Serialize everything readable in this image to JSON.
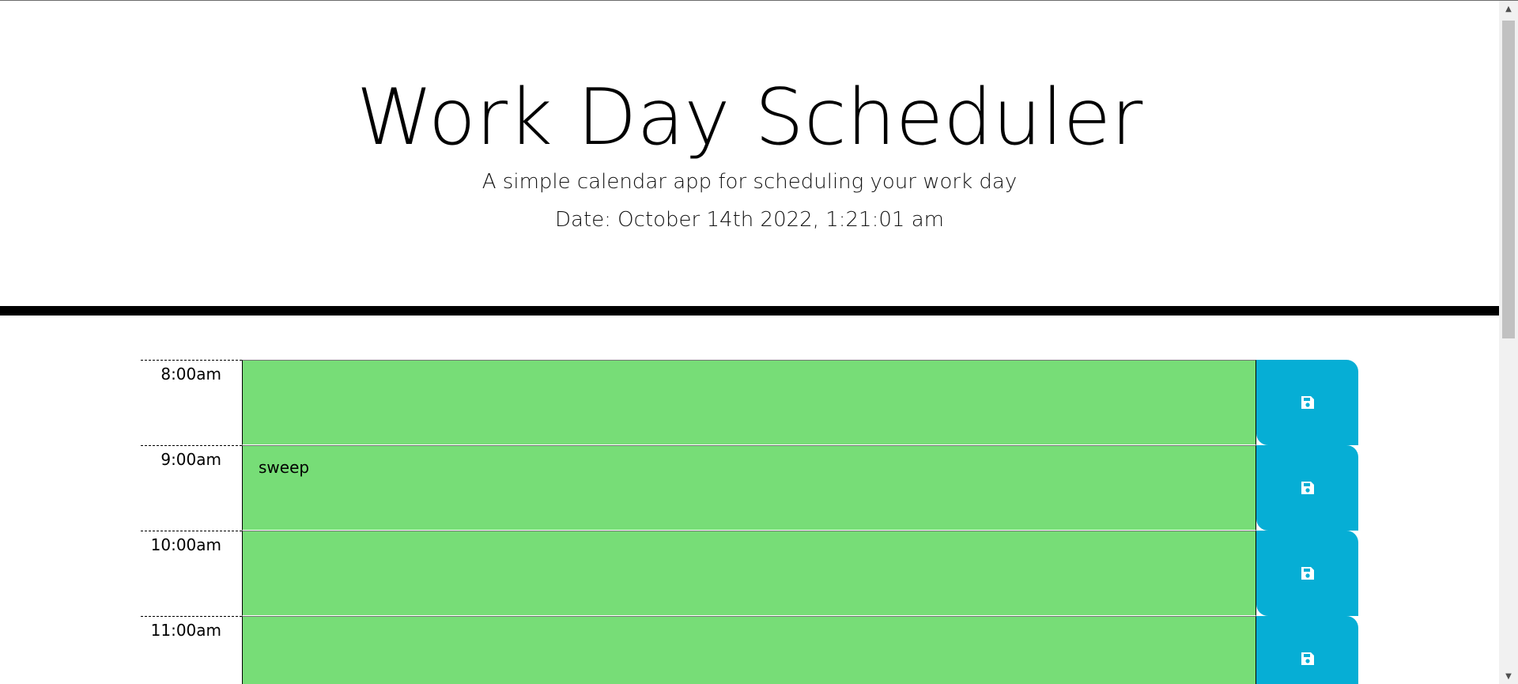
{
  "header": {
    "title": "Work Day Scheduler",
    "subtitle": "A simple calendar app for scheduling your work day",
    "date_text": "Date: October 14th 2022, 1:21:01 am"
  },
  "schedule": {
    "rows": [
      {
        "hour": "8:00am",
        "task": "",
        "status": "future"
      },
      {
        "hour": "9:00am",
        "task": "sweep",
        "status": "future"
      },
      {
        "hour": "10:00am",
        "task": "",
        "status": "future"
      },
      {
        "hour": "11:00am",
        "task": "",
        "status": "future"
      }
    ],
    "save_icon": "save-icon"
  },
  "colors": {
    "future": "#77dd77",
    "save_button": "#06aed5",
    "divider": "#000000"
  }
}
